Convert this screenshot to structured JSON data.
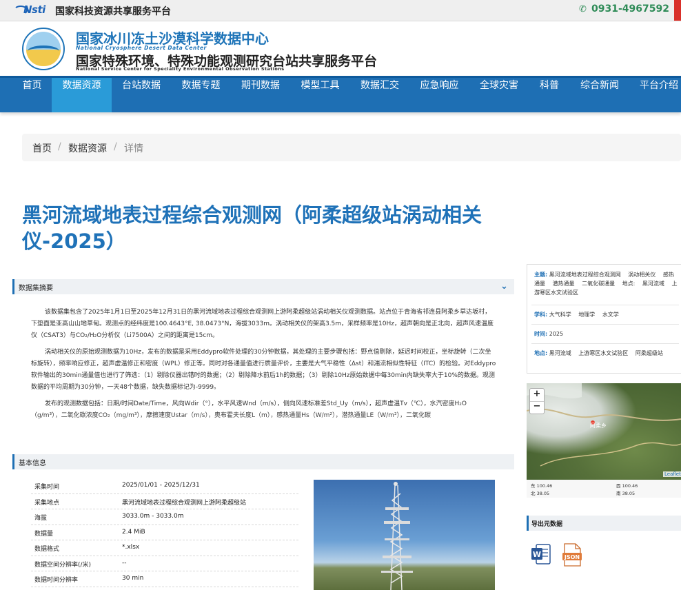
{
  "topbar": {
    "logo_text": "Nsti",
    "platform_name": "国家科技资源共享服务平台",
    "phone": "0931-4967592"
  },
  "header": {
    "title_cn": "国家冰川冻土沙漠科学数据中心",
    "title_en": "National Cryosphere Desert Data Center",
    "subtitle_cn": "国家特殊环境、特殊功能观测研究台站共享服务平台",
    "subtitle_en": "National Service Center for Speciality Environmental Observation Stations"
  },
  "nav": {
    "items": [
      "首页",
      "数据资源",
      "台站数据",
      "数据专题",
      "期刊数据",
      "模型工具",
      "数据汇交",
      "应急响应",
      "全球灾害",
      "科普",
      "综合新闻",
      "平台介绍"
    ],
    "active": "数据资源"
  },
  "breadcrumb": {
    "home": "首页",
    "section": "数据资源",
    "current": "详情",
    "separator": "/"
  },
  "page_title": "黑河流域地表过程综合观测网（阿柔超级站涡动相关仪-2025）",
  "summary": {
    "heading": "数据集摘要",
    "paragraphs": [
      "该数据集包含了2025年1月1日至2025年12月31日的黑河流域地表过程综合观测网上游阿柔超级站涡动相关仪观测数据。站点位于青海省祁连县阿柔乡草达坂村，下垫面是亚高山山地草甸。观测点的经纬度是100.4643°E, 38.0473°N，海拔3033m。涡动相关仪的架高3.5m，采样频率是10Hz，超声朝向是正北向，超声风速温度仪（CSAT3）与CO₂/H₂O分析仪（Li7500A）之间的距离是15cm。",
      "涡动相关仪的原始观测数据为10Hz，发布的数据是采用Eddypro软件处理的30分钟数据，其处理的主要步骤包括：野点值剔除，延迟时间校正，坐标旋转（二次坐标旋转），频率响应修正，超声虚温修正和密度（WPL）修正等。同时对各通量值进行质量评价，主要是大气平稳性（Δst）和湍流相似性特征（ITC）的检验。对Eddypro软件输出的30min通量值也进行了筛选：（1）剔除仪器出错时的数据；（2）剔除降水前后1h的数据；（3）剔除10Hz原始数据中每30min内缺失率大于10%的数据。观测数据的平均周期为30分钟，一天48个数据，缺失数据标记为-9999。",
      "发布的观测数据包括：日期/时间Date/Time，风向Wdir（°），水平风速Wnd（m/s），侧向风速标准差Std_Uy（m/s），超声虚温Tv（℃），水汽密度H₂O（g/m³），二氧化碳浓度CO₂（mg/m³），摩擦速度Ustar（m/s），奥布霍夫长度L（m），感热通量Hs（W/m²），潜热通量LE（W/m²），二氧化碳"
    ]
  },
  "basic_info": {
    "heading": "基本信息",
    "rows": [
      {
        "key": "采集时间",
        "value": "2025/01/01 - 2025/12/31"
      },
      {
        "key": "采集地点",
        "value": "黑河流域地表过程综合观测网上游阿柔超级站"
      },
      {
        "key": "海拔",
        "value": "3033.0m - 3033.0m"
      },
      {
        "key": "数据量",
        "value": "2.4 MiB"
      },
      {
        "key": "数据格式",
        "value": "*.xlsx"
      },
      {
        "key": "数据空间分辨率(/米)",
        "value": "--"
      },
      {
        "key": "数据时间分辨率",
        "value": "30 min"
      }
    ]
  },
  "sidebar": {
    "theme_label": "主题:",
    "theme_terms": [
      "黑河流域地表过程综合观测网",
      "涡动相关仪",
      "感热通量",
      "潜热通量",
      "二氧化碳通量"
    ],
    "place_label": "地点:",
    "place_inline": [
      "黑河流域",
      "上游寒区水文试验区"
    ],
    "discipline_label": "学科:",
    "disciplines": [
      "大气科学",
      "地理学",
      "水文学"
    ],
    "time_label": "时间:",
    "time_value": "2025",
    "location_label": "地点:",
    "locations": [
      "黑河流域",
      "上游寒区水文试验区",
      "阿柔超级站"
    ],
    "map": {
      "zoom_in": "+",
      "zoom_out": "−",
      "place_label": "阿柔乡",
      "attribution": "Leaflet",
      "coords": [
        "东 100.46",
        "北 38.05",
        "西 100.46",
        "南 38.05"
      ]
    },
    "export_heading": "导出元数据",
    "export_json_label": "JSON",
    "export_word_label": "W"
  },
  "colors": {
    "primary": "#1e6fb4",
    "nav_active": "#2a9bd8",
    "title": "#1f72b8",
    "phone": "#2e8b57"
  }
}
